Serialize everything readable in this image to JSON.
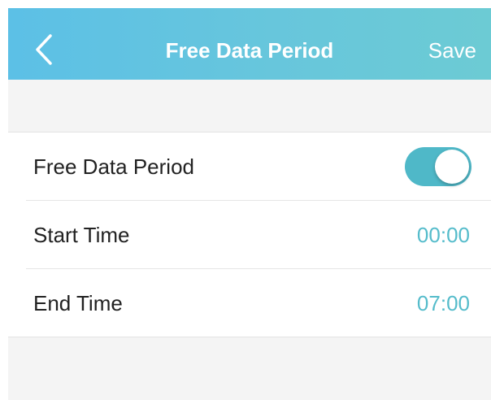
{
  "header": {
    "title": "Free Data Period",
    "save_label": "Save",
    "back_icon": "chevron-left-icon"
  },
  "settings": {
    "free_data_period": {
      "label": "Free Data Period",
      "enabled": true
    },
    "start_time": {
      "label": "Start Time",
      "value": "00:00"
    },
    "end_time": {
      "label": "End Time",
      "value": "07:00"
    }
  },
  "colors": {
    "header_gradient_start": "#5cc0e6",
    "header_gradient_end": "#6ccbd4",
    "accent": "#55bccb",
    "toggle_on": "#4fb8c8",
    "background": "#f4f4f4"
  }
}
